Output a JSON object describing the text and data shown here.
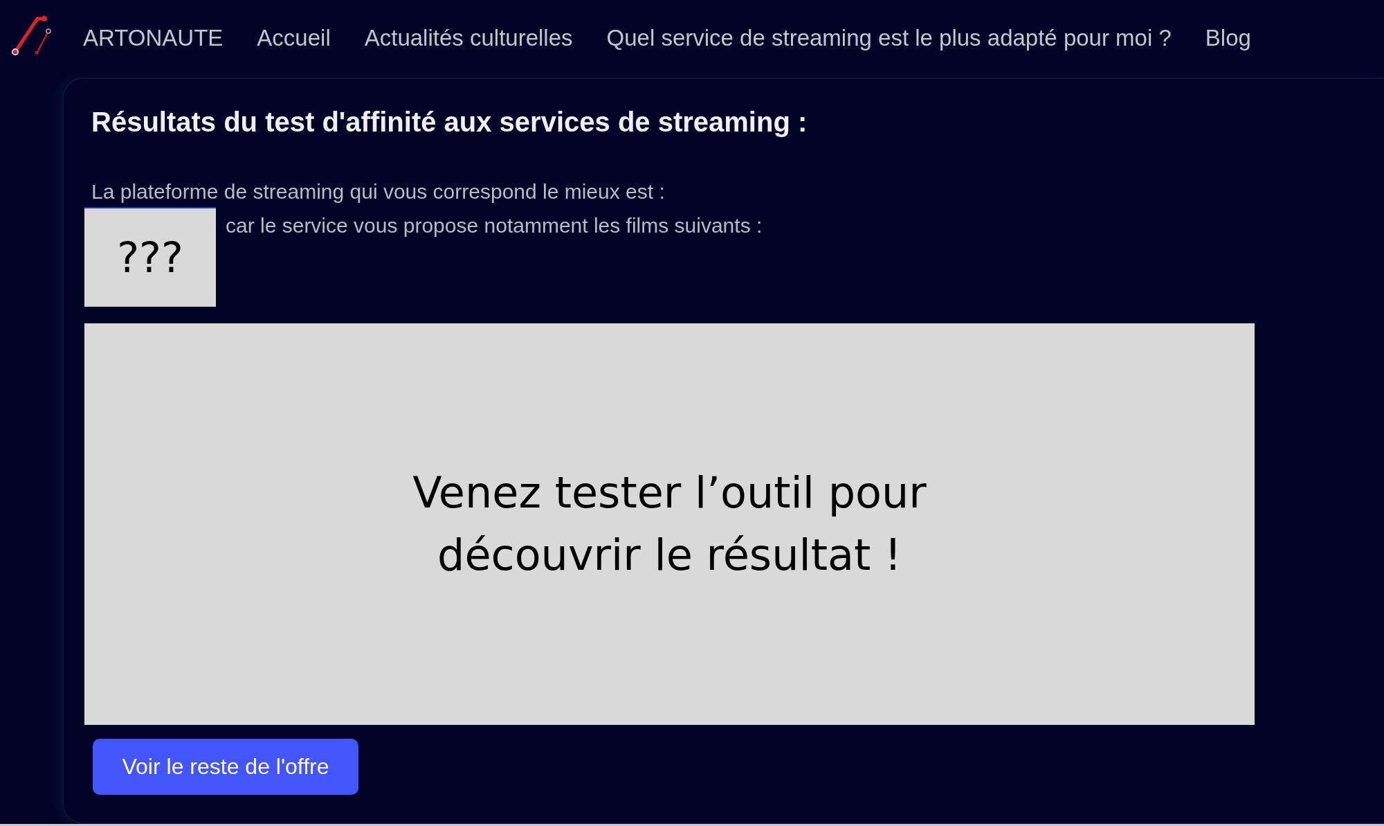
{
  "nav": {
    "brand": "ARTONAUTE",
    "links": [
      "Accueil",
      "Actualités culturelles",
      "Quel service de streaming est le plus adapté pour moi ?",
      "Blog"
    ]
  },
  "card": {
    "title": "Résultats du test d'affinité aux services de streaming :",
    "intro": "La plateforme de streaming qui vous correspond le mieux est :",
    "result_placeholder": "???",
    "films_intro": "car le service vous propose notamment les films suivants :",
    "overlay_message": [
      "Venez tester l’outil pour",
      "découvrir le résultat !"
    ],
    "button": "Voir le reste de l'offre"
  }
}
